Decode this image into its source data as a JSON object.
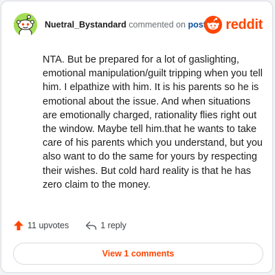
{
  "comment": {
    "username": "Nuetral_Bystandard",
    "action_text": "commented on",
    "post_link": "post",
    "body": "NTA. But be prepared for a lot of gaslighting, emotional manipulation/guilt tripping when you tell him. I elpathize with him. It is his parents so he is emotional about the issue. And when situations are emotionally charged, rationality flies right out the window. Maybe tell him.that he wants to take care of his parents which you understand, but you also want to do the same for yours by respecting their wishes. But cold hard reality is that he has zero claim to the money."
  },
  "brand": {
    "name": "reddit",
    "icon": "reddit-logo-icon",
    "color": "#ff4500"
  },
  "actions": {
    "upvotes_label": "11 upvotes",
    "upvote_icon": "upvote-arrow-icon",
    "reply_label": "1 reply",
    "reply_icon": "reply-arrow-icon"
  },
  "view_comments_label": "View 1 comments",
  "colors": {
    "accent": "#ff4500",
    "avatar_bg": "#a3dd56",
    "link": "#0a4fa0"
  }
}
